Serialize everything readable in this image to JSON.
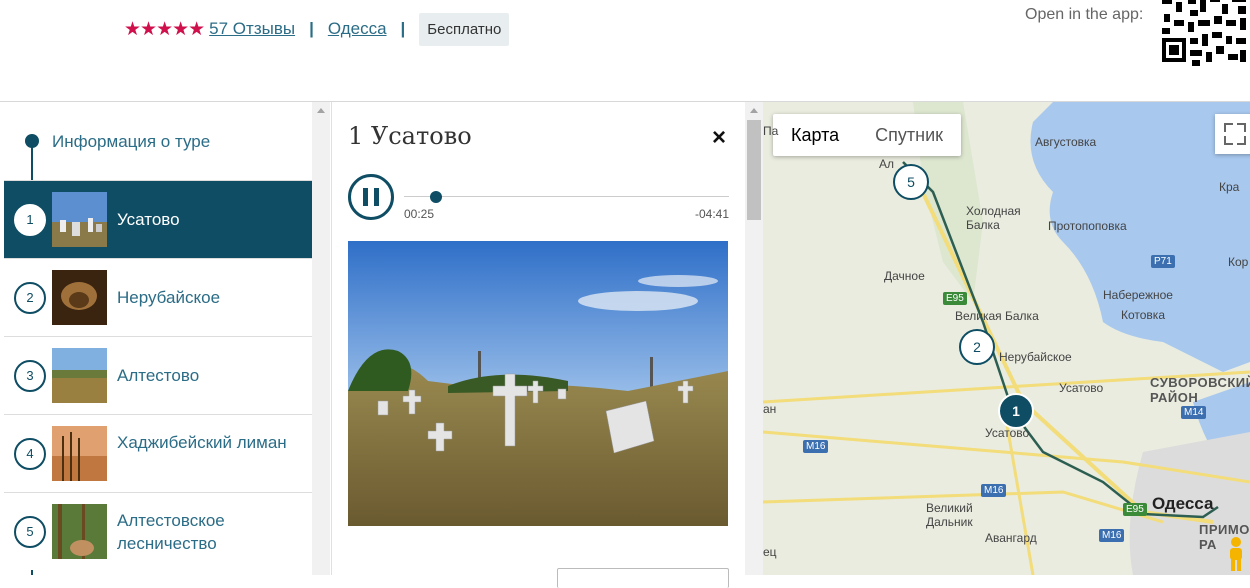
{
  "header": {
    "stars": "★★★★★",
    "reviews_link": "57 Отзывы",
    "separator": "|",
    "city_link": "Одесса",
    "price_badge": "Бесплатно",
    "open_in_app": "Open in the app:"
  },
  "sidebar": {
    "info_label": "Информация о туре",
    "stops": [
      {
        "num": "1",
        "label": "Усатово",
        "active": true
      },
      {
        "num": "2",
        "label": "Нерубайское",
        "active": false
      },
      {
        "num": "3",
        "label": "Алтестово",
        "active": false
      },
      {
        "num": "4",
        "label": "Хаджибейский лиман",
        "active": false
      },
      {
        "num": "5",
        "label": "Алтестовское лесничество",
        "active": false
      }
    ]
  },
  "player": {
    "title": "1 Усатово",
    "close": "×",
    "elapsed": "00:25",
    "remaining": "-04:41",
    "progress_fraction": 0.085
  },
  "map": {
    "tab_map": "Карта",
    "tab_satellite": "Спутник",
    "markers": [
      "5",
      "2",
      "1"
    ],
    "places": [
      "Августовка",
      "Ал",
      "Кра",
      "Холодная Балка",
      "Протопоповка",
      "Дачное",
      "Кор",
      "Набережное",
      "Великая Балка",
      "Котовка",
      "Нерубайское",
      "Усатово",
      "СУВОРОВСКИЙ РАЙОН",
      "Усатово",
      "ан",
      "Великий Дальник",
      "Одесса",
      "Авангард",
      "ПРИМОРСК РА",
      "ец",
      "Па"
    ],
    "road_shields": [
      "Е95",
      "P71",
      "M14",
      "M16",
      "M16",
      "E95",
      "M16"
    ]
  },
  "colors": {
    "accent": "#0e4d63",
    "stars": "#d0104c",
    "link": "#2b6c86"
  }
}
